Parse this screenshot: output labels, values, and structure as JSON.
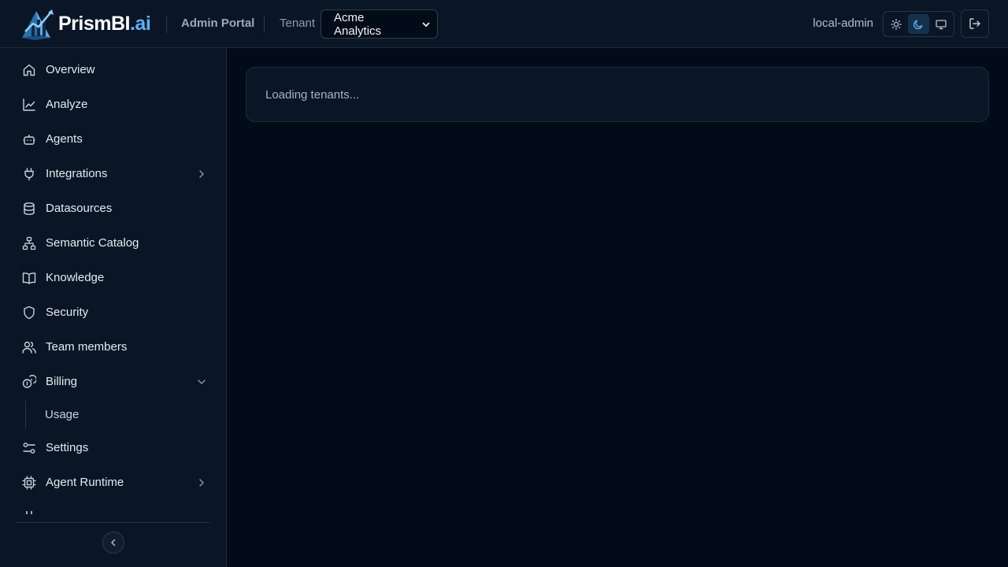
{
  "header": {
    "brand": {
      "name": "PrismBI",
      "suffix": ".ai"
    },
    "portal_label": "Admin Portal",
    "tenant_label": "Tenant",
    "tenant_selected": "Acme Analytics",
    "user_name": "local-admin"
  },
  "sidebar": {
    "items": [
      {
        "label": "Overview",
        "icon": "home-icon"
      },
      {
        "label": "Analyze",
        "icon": "line-chart-icon"
      },
      {
        "label": "Agents",
        "icon": "bot-icon"
      },
      {
        "label": "Integrations",
        "icon": "plug-icon"
      },
      {
        "label": "Datasources",
        "icon": "database-icon"
      },
      {
        "label": "Semantic Catalog",
        "icon": "network-icon"
      },
      {
        "label": "Knowledge",
        "icon": "book-icon"
      },
      {
        "label": "Security",
        "icon": "shield-icon"
      },
      {
        "label": "Team members",
        "icon": "users-icon"
      },
      {
        "label": "Billing",
        "icon": "coins-icon"
      },
      {
        "label": "Settings",
        "icon": "sliders-icon"
      },
      {
        "label": "Agent Runtime",
        "icon": "cpu-icon"
      }
    ],
    "billing_sub": {
      "label": "Usage"
    }
  },
  "main": {
    "loading_text": "Loading tenants..."
  },
  "colors": {
    "background": "#020c19",
    "panel": "#0a1626",
    "accent": "#5fb0f0"
  }
}
